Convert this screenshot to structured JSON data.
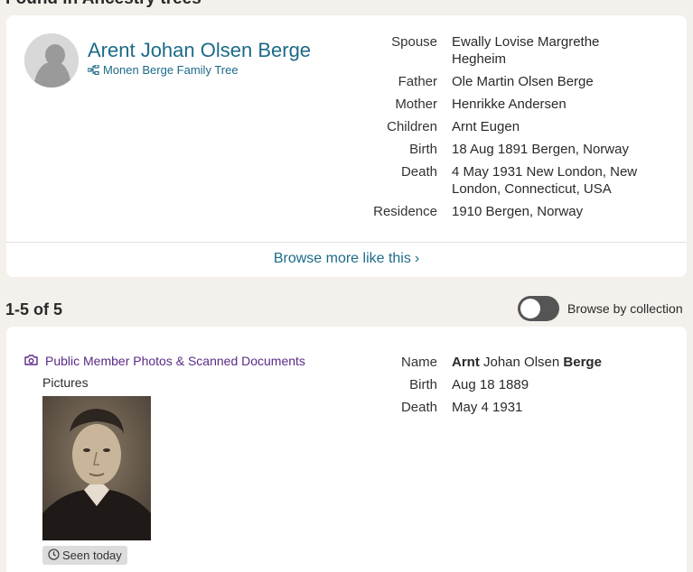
{
  "section": {
    "title": "Found in Ancestry trees"
  },
  "tree_card": {
    "name": "Arent Johan Olsen Berge",
    "tree_name": "Monen Berge Family Tree",
    "facts": [
      {
        "label": "Spouse",
        "value": "Ewally Lovise Margrethe Hegheim"
      },
      {
        "label": "Father",
        "value": "Ole Martin Olsen Berge"
      },
      {
        "label": "Mother",
        "value": "Henrikke Andersen"
      },
      {
        "label": "Children",
        "value": "Arnt Eugen"
      },
      {
        "label": "Birth",
        "value": "18 Aug 1891 Bergen, Norway"
      },
      {
        "label": "Death",
        "value": "4 May 1931 New London, New London, Connecticut, USA"
      },
      {
        "label": "Residence",
        "value": "1910 Bergen, Norway"
      }
    ],
    "browse_more": "Browse more like this"
  },
  "results": {
    "count_label": "1-5 of 5",
    "toggle_label": "Browse by collection",
    "toggle_on": false
  },
  "record_card": {
    "collection": "Public Member Photos & Scanned Documents",
    "collection_type": "Pictures",
    "seen_label": "Seen today",
    "facts": {
      "name_label": "Name",
      "name_first_bold": "Arnt",
      "name_middle": " Johan Olsen ",
      "name_last_bold": "Berge",
      "birth_label": "Birth",
      "birth_value": "Aug 18 1889",
      "death_label": "Death",
      "death_value": "May 4 1931"
    }
  },
  "colors": {
    "link": "#1c6b88",
    "collection_link": "#5b2a86",
    "background": "#f4f0ec",
    "toggle_off": "#555555"
  },
  "icons": {
    "tree": "tree-icon",
    "camera": "camera-icon",
    "clock": "clock-icon",
    "chevron": "chevron-right-icon"
  }
}
